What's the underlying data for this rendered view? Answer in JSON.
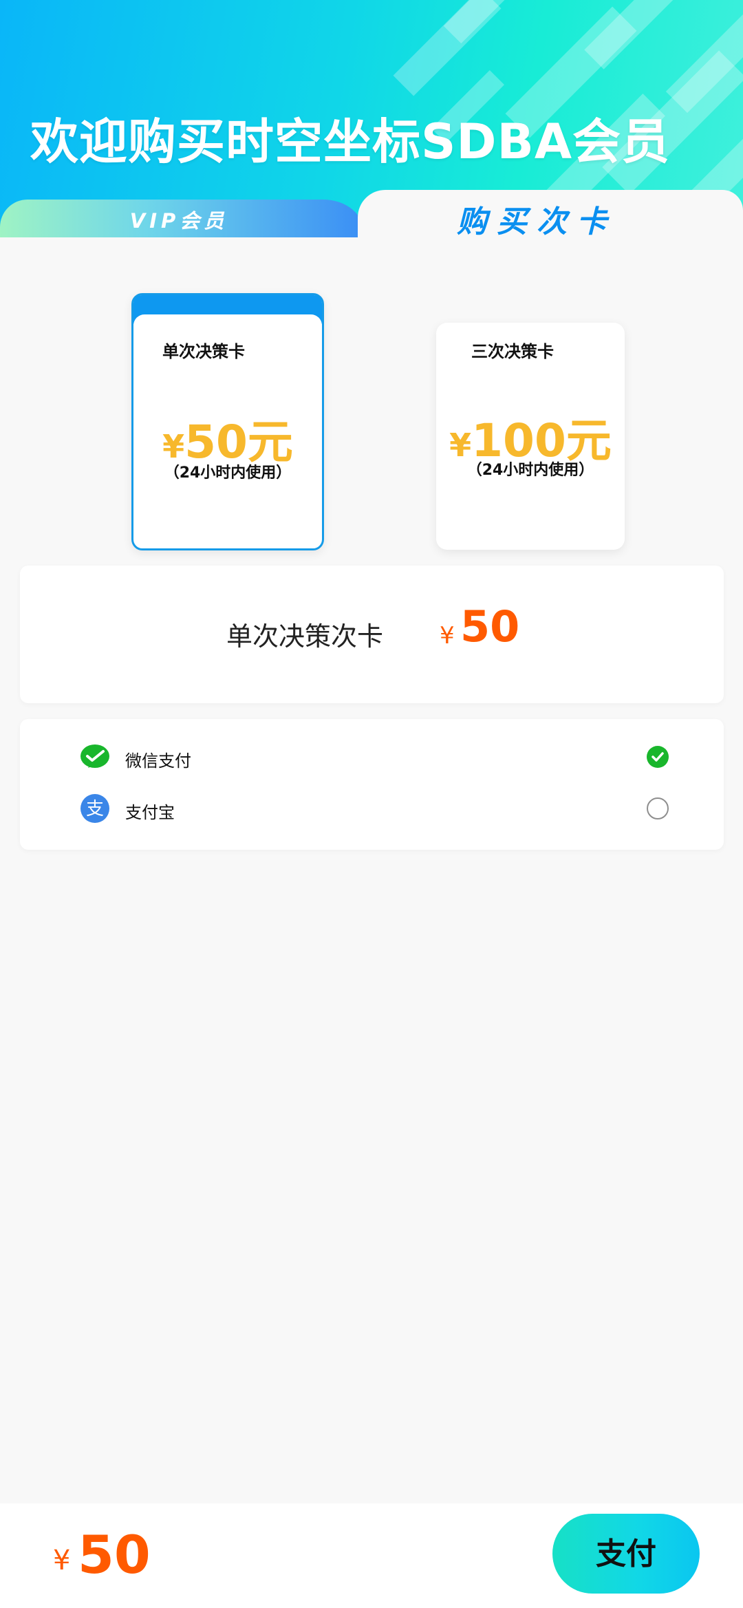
{
  "header": {
    "title": "欢迎购买时空坐标SDBA会员"
  },
  "tabs": [
    {
      "label": "VIP会员",
      "active": false
    },
    {
      "label": "购买次卡",
      "active": true
    }
  ],
  "cards": [
    {
      "name": "单次决策卡",
      "price": "50元",
      "currency": "¥",
      "note": "（24小时内使用）",
      "selected": true
    },
    {
      "name": "三次决策卡",
      "price": "100元",
      "currency": "¥",
      "note": "（24小时内使用）",
      "selected": false
    }
  ],
  "summary": {
    "item_name": "单次决策次卡",
    "currency": "¥",
    "amount": "50"
  },
  "payment_methods": [
    {
      "label": "微信支付",
      "icon": "wechat-pay-icon",
      "selected": true
    },
    {
      "label": "支付宝",
      "icon": "alipay-icon",
      "selected": false
    }
  ],
  "bottom": {
    "currency": "¥",
    "amount": "50",
    "pay_label": "支付"
  },
  "colors": {
    "accent_blue": "#0e98f0",
    "price_yellow": "#f7b82c",
    "price_orange": "#ff5a00",
    "wechat_green": "#19b62c",
    "alipay_blue": "#3a86e8"
  }
}
